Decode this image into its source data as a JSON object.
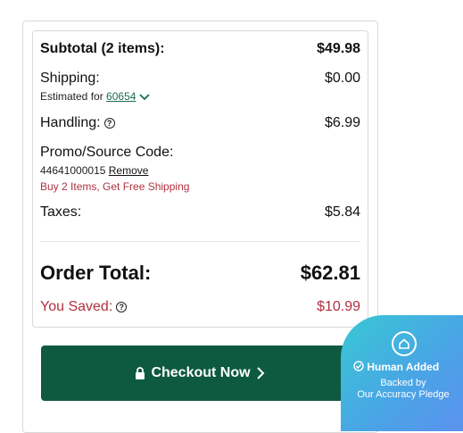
{
  "subtotal": {
    "label": "Subtotal (2 items):",
    "value": "$49.98"
  },
  "shipping": {
    "label": "Shipping:",
    "value": "$0.00",
    "estimated_prefix": "Estimated for",
    "zip": "60654"
  },
  "handling": {
    "label": "Handling:",
    "value": "$6.99"
  },
  "promo": {
    "label": "Promo/Source Code:",
    "code": "44641000015",
    "remove_label": "Remove",
    "message": "Buy 2 Items, Get Free Shipping"
  },
  "taxes": {
    "label": "Taxes:",
    "value": "$5.84"
  },
  "order_total": {
    "label": "Order Total:",
    "value": "$62.81"
  },
  "saved": {
    "label": "You Saved:",
    "value": "$10.99"
  },
  "checkout": {
    "label": "Checkout Now"
  },
  "badge": {
    "title": "Human Added",
    "line1": "Backed by",
    "line2": "Our Accuracy Pledge"
  },
  "colors": {
    "brand_green": "#0d5a41",
    "savings_red": "#b0313f",
    "link_green": "#1b6b52",
    "badge": "#4aa3e6"
  },
  "icons": [
    "help-icon",
    "chevron-down-icon",
    "lock-icon",
    "chevron-right-icon",
    "house-icon",
    "check-circle-icon"
  ]
}
